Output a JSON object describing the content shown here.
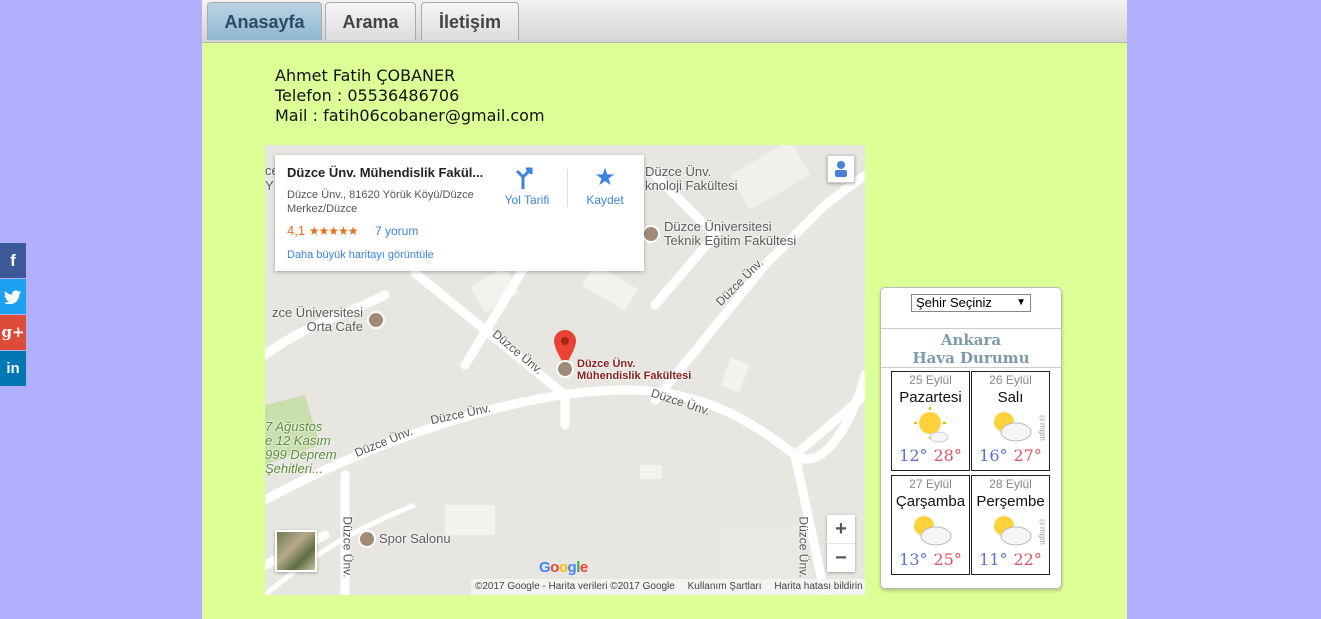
{
  "tabs": [
    {
      "label": "Anasayfa",
      "active": true
    },
    {
      "label": "Arama",
      "active": false
    },
    {
      "label": "İletişim",
      "active": false
    }
  ],
  "contact": {
    "name": "Ahmet Fatih ÇOBANER",
    "phone": "Telefon : 05536486706",
    "mail": "Mail : fatih06cobaner@gmail.com"
  },
  "map": {
    "card": {
      "title": "Düzce Ünv. Mühendislik Fakül...",
      "address": "Düzce Ünv., 81620 Yörük Köyü/Düzce Merkez/Düzce",
      "rating": "4,1",
      "stars": "★★★★★",
      "reviews": "7 yorum",
      "bigger_map": "Daha büyük haritayı görüntüle",
      "directions": "Yol Tarifi",
      "save": "Kaydet"
    },
    "labels": {
      "teknoloji": "Düzce Ünv.\nknoloji Fakültesi",
      "teknik": "Düzce Üniversitesi\nTeknik Eğitim Fakültesi",
      "cafe": "zce Üniversitesi\nOrta Cafe",
      "muh": "Düzce Ünv.\nMühendislik Fakültesi",
      "agustos": "7 Ağustos\ne 12 Kasım\n999 Deprem\nŞehitleri...",
      "spor": "Spor Salonu",
      "road": "Düzce Ünv.",
      "co": "ce\nY"
    },
    "zoom_in": "+",
    "zoom_out": "−",
    "google_logo": "Google",
    "attribution": "©2017 Google - Harita verileri ©2017 Google",
    "terms": "Kullanım Şartları",
    "report": "Harita hatası bildirin"
  },
  "weather": {
    "select_label": "Şehir Seçiniz",
    "city": "Ankara",
    "heading": "Hava Durumu",
    "credit": "©mgm",
    "days": [
      {
        "date": "25 Eylül",
        "name": "Pazartesi",
        "min": "12°",
        "max": "28°",
        "icon": "sun"
      },
      {
        "date": "26 Eylül",
        "name": "Salı",
        "min": "16°",
        "max": "27°",
        "icon": "partly-cloudy"
      },
      {
        "date": "27 Eylül",
        "name": "Çarşamba",
        "min": "13°",
        "max": "25°",
        "icon": "partly-cloudy"
      },
      {
        "date": "28 Eylül",
        "name": "Perşembe",
        "min": "11°",
        "max": "22°",
        "icon": "partly-cloudy"
      }
    ]
  },
  "social": [
    {
      "icon": "facebook-icon",
      "glyph": "f",
      "color": "#3b5998"
    },
    {
      "icon": "twitter-icon",
      "glyph": "t",
      "color": "#1da1f2"
    },
    {
      "icon": "google-plus-icon",
      "glyph": "g+",
      "color": "#dd4b39"
    },
    {
      "icon": "linkedin-icon",
      "glyph": "in",
      "color": "#0077b5"
    }
  ],
  "colors": {
    "background": "#b0b0ff",
    "content": "#dcff96",
    "accent_tab": "#8fb7d0"
  }
}
